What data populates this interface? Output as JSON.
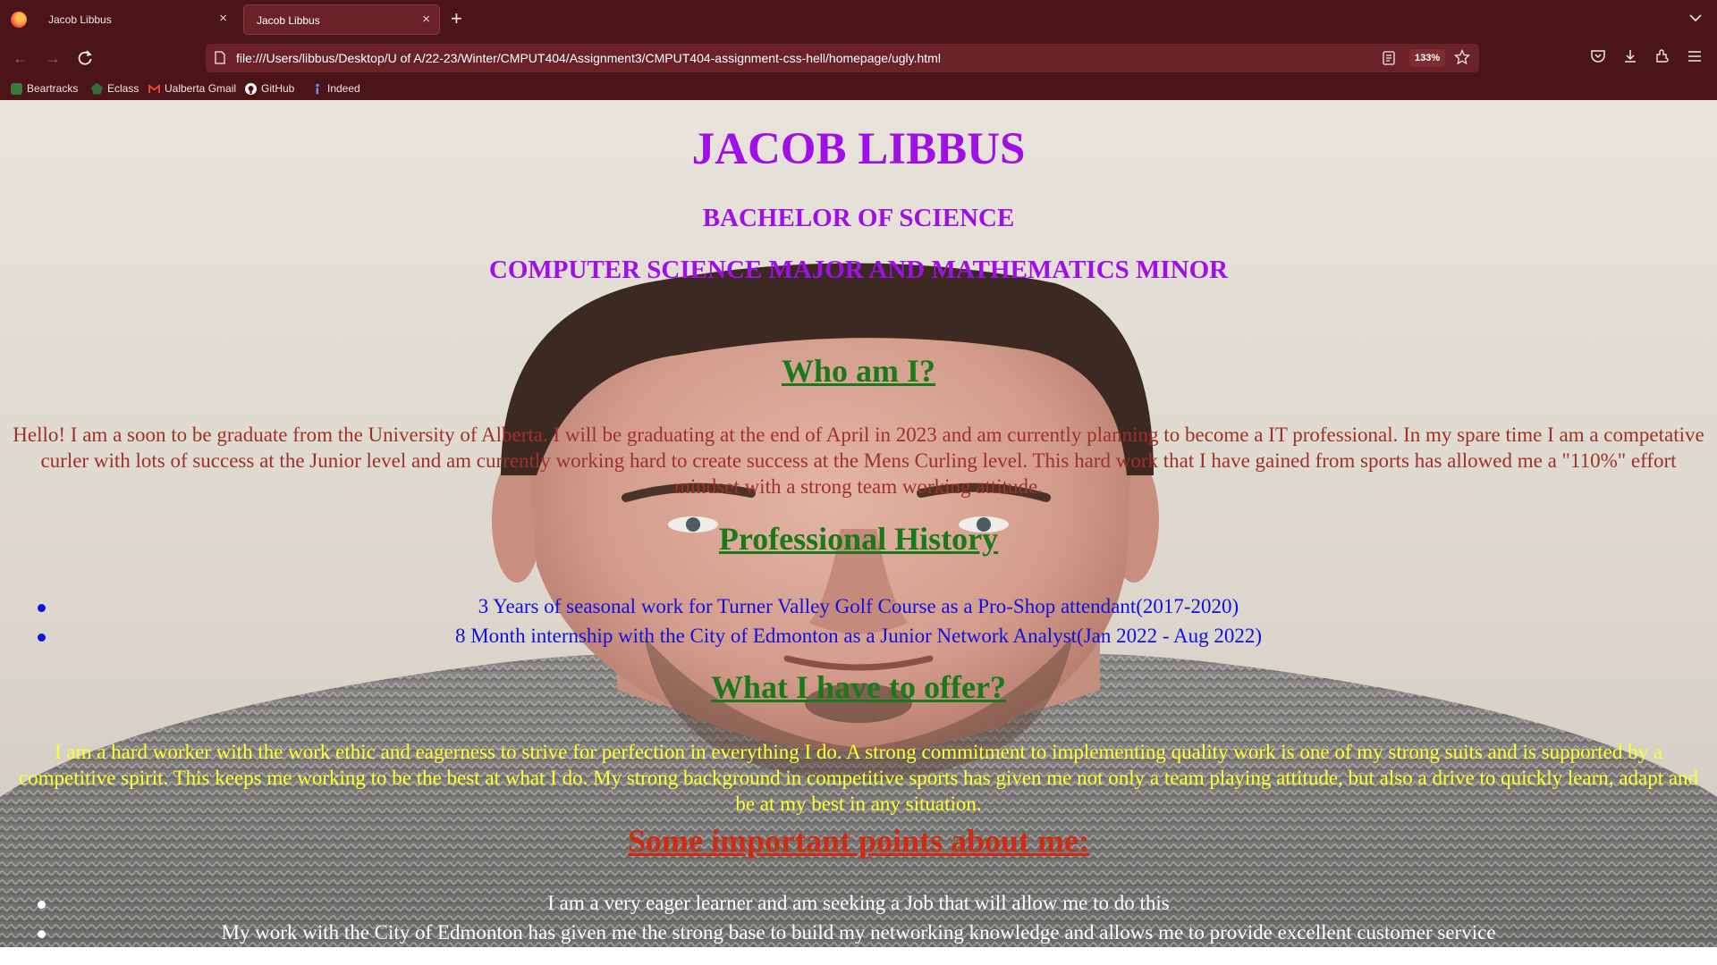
{
  "browser": {
    "tabs": [
      {
        "title": "Jacob Libbus",
        "active": false
      },
      {
        "title": "Jacob Libbus",
        "active": true
      }
    ],
    "url": "file:///Users/libbus/Desktop/U of A/22-23/Winter/CMPUT404/Assignment3/CMPUT404-assignment-css-hell/homepage/ugly.html",
    "zoom": "133%",
    "bookmarks": [
      "Beartracks",
      "Eclass",
      "Ualberta Gmail",
      "GitHub",
      "Indeed"
    ]
  },
  "page": {
    "name": "JACOB LIBBUS",
    "degree": "BACHELOR OF SCIENCE",
    "major": "COMPUTER SCIENCE MAJOR AND MATHEMATICS MINOR",
    "who_heading": "Who am I?",
    "who_text": "Hello! I am a soon to be graduate from the University of Alberta. I will be graduating at the end of April in 2023 and am currently planning to become a IT professional. In my spare time I am a competative curler with lots of success at the Junior level and am currently working hard to create success at the Mens Curling level. This hard work that I have gained from sports has allowed me a \"110%\" effort mindset with a strong team working attitude.",
    "history_heading": "Professional History",
    "history": [
      "3 Years of seasonal work for Turner Valley Golf Course as a Pro-Shop attendant(2017-2020)",
      "8 Month internship with the City of Edmonton as a Junior Network Analyst(Jan 2022 - Aug 2022)"
    ],
    "offer_heading": "What I have to offer?",
    "offer_text": "I am a hard worker with the work ethic and eagerness to strive for perfection in everything I do. A strong commitment to implementing quality work is one of my strong suits and is supported by a competitive spirit. This keeps me working to be the best at what I do. My strong background in competitive sports has given me not only a team playing attitude, but also a drive to quickly learn, adapt and be at my best in any situation.",
    "points_heading": "Some important points about me:",
    "points": [
      "I am a very eager learner and am seeking a Job that will allow me to do this",
      "My work with the City of Edmonton has given me the strong base to build my networking knowledge and allows me to provide excellent customer service"
    ]
  },
  "colors": {
    "chrome": "#4a1418",
    "title": "#a010e6",
    "section_heading": "#1a7a1a",
    "who_text": "#a0302a",
    "history_text": "#1010e0",
    "offer_text": "#ffff33",
    "points_heading": "#d02a10",
    "points_text": "#ffffff"
  }
}
